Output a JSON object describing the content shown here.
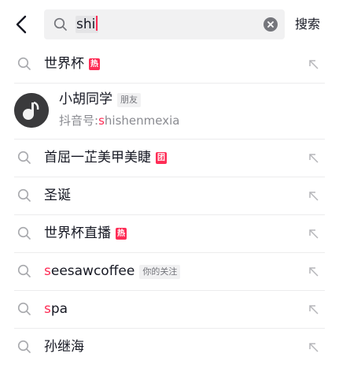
{
  "search": {
    "query": "shi",
    "button_label": "搜索"
  },
  "suggestions": [
    {
      "pre": "",
      "hl": "",
      "text": "世界杯",
      "tag": "热",
      "tag_type": "hot"
    },
    {
      "pre": "",
      "hl": "",
      "text": "首屈一芷美甲美睫",
      "tag": "团",
      "tag_type": "group"
    },
    {
      "pre": "",
      "hl": "",
      "text": "圣诞",
      "tag": "",
      "tag_type": ""
    },
    {
      "pre": "",
      "hl": "",
      "text": "世界杯直播",
      "tag": "热",
      "tag_type": "hot"
    },
    {
      "pre": "",
      "hl": "s",
      "text": "eesawcoffee",
      "tag": "你的关注",
      "tag_type": "gray"
    },
    {
      "pre": "",
      "hl": "s",
      "text": "pa",
      "tag": "",
      "tag_type": ""
    },
    {
      "pre": "",
      "hl": "",
      "text": "孙继海",
      "tag": "",
      "tag_type": ""
    }
  ],
  "user": {
    "name": "小胡同学",
    "relation": "朋友",
    "id_prefix": "抖音号:",
    "id_highlight": "s",
    "id_rest": "hishenmexia"
  },
  "colors": {
    "accent": "#fe2c55",
    "text": "#161823",
    "secondary": "#8a8b91",
    "input_bg": "#f1f1f2"
  }
}
